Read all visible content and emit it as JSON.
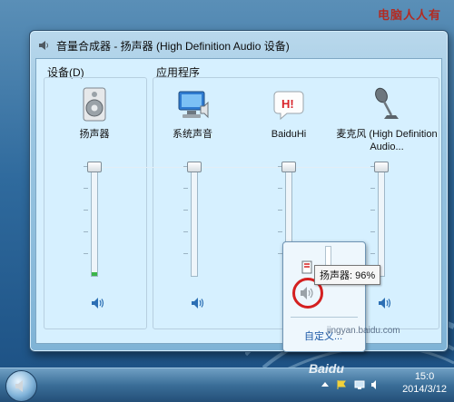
{
  "watermark": {
    "top_right": "电脑人人有",
    "baidu_text": "Baidu",
    "url_fragment": "jingyan.baidu.com"
  },
  "window": {
    "title": "音量合成器 - 扬声器 (High Definition Audio 设备)",
    "devices_label_prefix": "设备(",
    "devices_label_key": "D",
    "devices_label_suffix": ")",
    "apps_label": "应用程序"
  },
  "channels": [
    {
      "id": "speaker",
      "name": "扬声器",
      "icon": "speaker-icon",
      "level": 0.96
    },
    {
      "id": "system",
      "name": "系统声音",
      "icon": "system-sounds-icon",
      "level": 0.96
    },
    {
      "id": "baiduhi",
      "name": "BaiduHi",
      "icon": "baiduhi-icon",
      "level": 0.96
    },
    {
      "id": "mic",
      "name": "麦克风 (High Definition Audio...",
      "icon": "microphone-icon",
      "level": 0.96
    }
  ],
  "popup": {
    "tooltip": "扬声器: 96%",
    "customize_link": "自定义..."
  },
  "taskbar": {
    "time": "15:0",
    "date": "2014/3/12"
  },
  "colors": {
    "accent_red": "#d42020",
    "slider_fill": "#3bb54a",
    "window_frame": "#9cc7e2"
  }
}
